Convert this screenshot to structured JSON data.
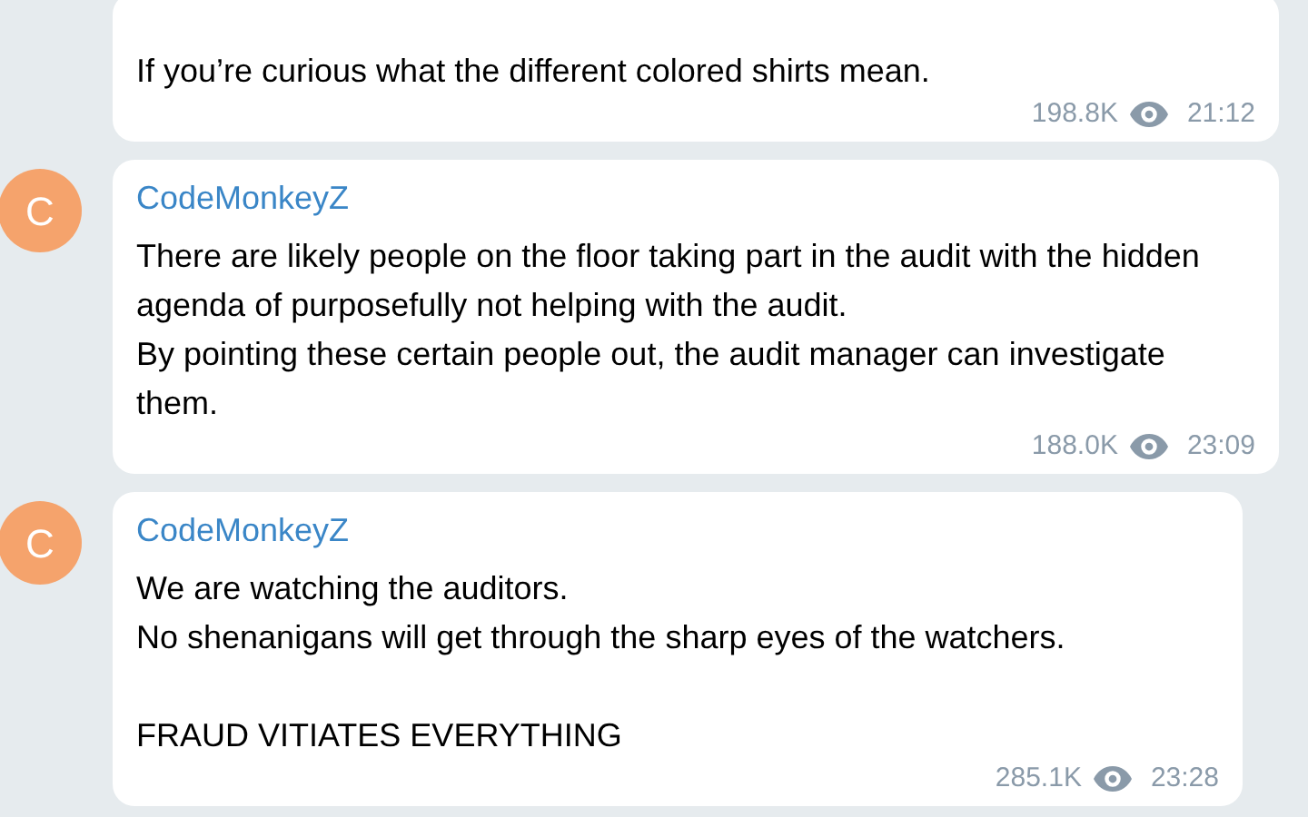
{
  "messages": [
    {
      "text": "If you’re curious what the different colored shirts mean.",
      "views": "198.8K",
      "time": "21:12"
    },
    {
      "author": "CodeMonkeyZ",
      "avatar": "C",
      "text": "There are likely people on the floor taking part in the audit with the hidden agenda of purposefully not helping with the audit.\nBy pointing these certain people out, the audit manager can investigate them.",
      "views": "188.0K",
      "time": "23:09"
    },
    {
      "author": "CodeMonkeyZ",
      "avatar": "C",
      "text": "We are watching the auditors.\nNo shenanigans will get through the sharp eyes of the watchers.\n\nFRAUD VITIATES EVERYTHING",
      "views": "285.1K",
      "time": "23:28"
    }
  ]
}
